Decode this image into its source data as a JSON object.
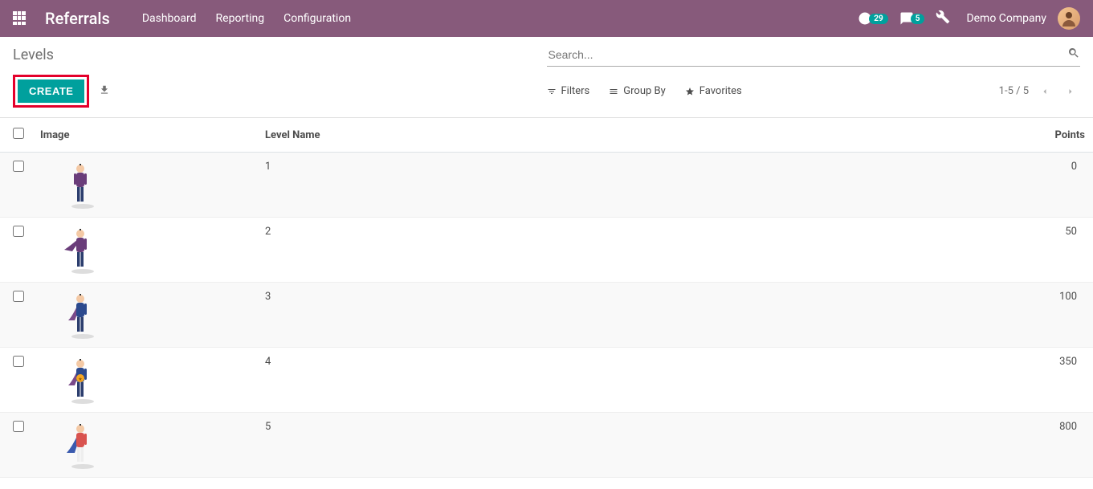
{
  "navbar": {
    "brand": "Referrals",
    "links": [
      "Dashboard",
      "Reporting",
      "Configuration"
    ],
    "timer_badge": "29",
    "msg_badge": "5",
    "company": "Demo Company"
  },
  "breadcrumb": {
    "title": "Levels"
  },
  "search": {
    "placeholder": "Search..."
  },
  "toolbar": {
    "create_label": "Create",
    "filters_label": "Filters",
    "groupby_label": "Group By",
    "favorites_label": "Favorites",
    "pager": "1-5 / 5"
  },
  "table": {
    "headers": {
      "image": "Image",
      "level_name": "Level Name",
      "points": "Points"
    },
    "rows": [
      {
        "level_name": "1",
        "points": "0"
      },
      {
        "level_name": "2",
        "points": "50"
      },
      {
        "level_name": "3",
        "points": "100"
      },
      {
        "level_name": "4",
        "points": "350"
      },
      {
        "level_name": "5",
        "points": "800"
      }
    ]
  },
  "chart_data": {
    "type": "table",
    "columns": [
      "Level Name",
      "Points"
    ],
    "rows": [
      [
        "1",
        0
      ],
      [
        "2",
        50
      ],
      [
        "3",
        100
      ],
      [
        "4",
        350
      ],
      [
        "5",
        800
      ]
    ]
  }
}
